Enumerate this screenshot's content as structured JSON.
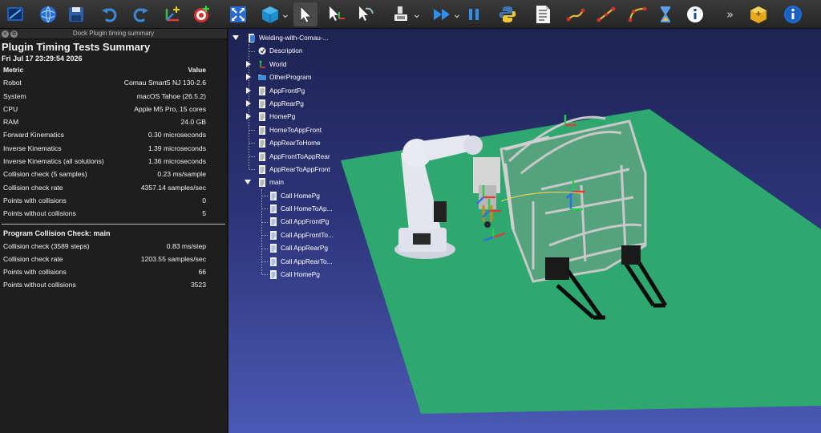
{
  "colors": {
    "toolbar_bg": "#2e2e2e",
    "dock_bg": "#1e1e1e",
    "viewport_top": "#1d2352",
    "viewport_bottom": "#4a59b4",
    "floor": "#2ea86f",
    "accent_blue": "#1a6fd6"
  },
  "toolbar": {
    "items": [
      {
        "name": "new-station-icon"
      },
      {
        "name": "open-library-icon"
      },
      {
        "name": "save-icon"
      },
      {
        "name": "undo-icon"
      },
      {
        "name": "redo-icon"
      },
      {
        "name": "add-frame-icon"
      },
      {
        "name": "add-target-icon"
      },
      {
        "name": "fit-all-icon"
      },
      {
        "name": "view-cube-icon"
      },
      {
        "name": "select-icon"
      },
      {
        "name": "select-frame-icon"
      },
      {
        "name": "move-tcp-icon"
      },
      {
        "name": "render-mode-icon"
      },
      {
        "name": "play-fast-icon"
      },
      {
        "name": "pause-icon"
      },
      {
        "name": "python-script-icon"
      },
      {
        "name": "program-document-icon"
      },
      {
        "name": "linear-move-icon"
      },
      {
        "name": "joint-move-icon"
      },
      {
        "name": "circular-move-icon"
      },
      {
        "name": "pause-timer-icon"
      },
      {
        "name": "info-icon"
      },
      {
        "name": "more-chevron-icon"
      },
      {
        "name": "plugin-box-icon"
      },
      {
        "name": "help-info-icon"
      }
    ]
  },
  "dock": {
    "title": "Dock Plugin timing summary",
    "close_glyph": "×",
    "float_glyph": "⧉"
  },
  "report": {
    "title": "Plugin Timing Tests Summary",
    "date": "Fri Jul 17 23:29:54 2026",
    "header": {
      "metric": "Metric",
      "value": "Value"
    },
    "rows": [
      {
        "metric": "Robot",
        "value": "Comau Smart5 NJ 130-2.6"
      },
      {
        "metric": "System",
        "value": "macOS Tahoe (26.5.2)"
      },
      {
        "metric": "CPU",
        "value": "Apple M5 Pro, 15 cores"
      },
      {
        "metric": "RAM",
        "value": "24.0 GB"
      },
      {
        "metric": "Forward Kinematics",
        "value": "0.30 microseconds"
      },
      {
        "metric": "Inverse Kinematics",
        "value": "1.39 microseconds"
      },
      {
        "metric": "Inverse Kinematics (all solutions)",
        "value": "1.36 microseconds"
      },
      {
        "metric": "Collision check (5 samples)",
        "value": "0.23 ms/sample"
      },
      {
        "metric": "Collision check rate",
        "value": "4357.14 samples/sec"
      },
      {
        "metric": "Points with collisions",
        "value": "0"
      },
      {
        "metric": "Points without collisions",
        "value": "5"
      }
    ],
    "section2_title": "Program Collision Check: main",
    "rows2": [
      {
        "metric": "Collision check (3589 steps)",
        "value": "0.83 ms/step"
      },
      {
        "metric": "Collision check rate",
        "value": "1203.55 samples/sec"
      },
      {
        "metric": "Points with collisions",
        "value": "66"
      },
      {
        "metric": "Points without collisions",
        "value": "3523"
      }
    ]
  },
  "tree": {
    "root": "Welding-with-Comau-...",
    "items": [
      {
        "label": "Description",
        "icon": "note-icon",
        "expandable": false
      },
      {
        "label": "World",
        "icon": "world-frame-icon",
        "expandable": true
      },
      {
        "label": "OtherProgram",
        "icon": "folder-icon",
        "expandable": true
      },
      {
        "label": "AppFrontPg",
        "icon": "program-icon",
        "expandable": true
      },
      {
        "label": "AppRearPg",
        "icon": "program-icon",
        "expandable": true
      },
      {
        "label": "HomePg",
        "icon": "program-icon",
        "expandable": true
      },
      {
        "label": "HomeToAppFront",
        "icon": "program-icon",
        "expandable": false
      },
      {
        "label": "AppRearToHome",
        "icon": "program-icon",
        "expandable": false
      },
      {
        "label": "AppFrontToAppRear",
        "icon": "program-icon",
        "expandable": false
      },
      {
        "label": "AppRearToAppFront",
        "icon": "program-icon",
        "expandable": false
      }
    ],
    "main": {
      "label": "main",
      "children": [
        "Call HomePg",
        "Call HomeToAp...",
        "Call AppFrontPg",
        "Call AppFrontTo...",
        "Call AppRearPg",
        "Call AppRearTo...",
        "Call HomePg"
      ]
    }
  }
}
